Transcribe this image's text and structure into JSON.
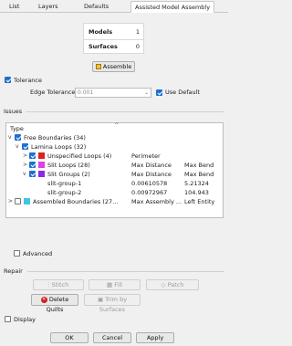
{
  "tabs": [
    {
      "label": "List"
    },
    {
      "label": "Layers"
    },
    {
      "label": "Defaults"
    },
    {
      "label": "Assisted Model Assembly"
    }
  ],
  "stats": {
    "models_label": "Models",
    "models_value": "1",
    "surfaces_label": "Surfaces",
    "surfaces_value": "0"
  },
  "assemble_button": "Assemble",
  "tolerance": {
    "checkbox_label": "Tolerance",
    "edge_label": "Edge Tolerance:",
    "edge_value": "0.001",
    "use_default_label": "Use Default"
  },
  "issues": {
    "section_label": "Issues",
    "column_type": "Type",
    "rows": [
      {
        "label": "Free Boundaries (34)",
        "col1": "",
        "col2": ""
      },
      {
        "label": "Lamina Loops (32)",
        "col1": "",
        "col2": ""
      },
      {
        "label": "Unspecified Loops (4)",
        "col1": "Perimeter",
        "col2": ""
      },
      {
        "label": "Slit Loops (28)",
        "col1": "Max Distance",
        "col2": "Max Bend"
      },
      {
        "label": "Slit Groups (2)",
        "col1": "Max Distance",
        "col2": "Max Bend"
      },
      {
        "label": "slit-group-1",
        "col1": "0.00610578",
        "col2": "5.21324"
      },
      {
        "label": "slit-group-2",
        "col1": "0.00972967",
        "col2": "104.943"
      },
      {
        "label": "Assembled Boundaries (27...",
        "col1": "Max Assembly ...",
        "col2": "Left Entity"
      }
    ],
    "colors": {
      "unspecified": "#e02020",
      "slit_loops": "#e040e0",
      "slit_groups": "#8a2be2",
      "assembled": "#3ec8e0"
    }
  },
  "advanced_label": "Advanced",
  "repair": {
    "section_label": "Repair",
    "stitch": "Stitch",
    "fill": "Fill",
    "patch": "Patch",
    "delete_quilts": "Delete Quilts",
    "trim_by_surfaces": "Trim by Surfaces"
  },
  "display_label": "Display",
  "footer": {
    "ok": "OK",
    "cancel": "Cancel",
    "apply": "Apply"
  }
}
